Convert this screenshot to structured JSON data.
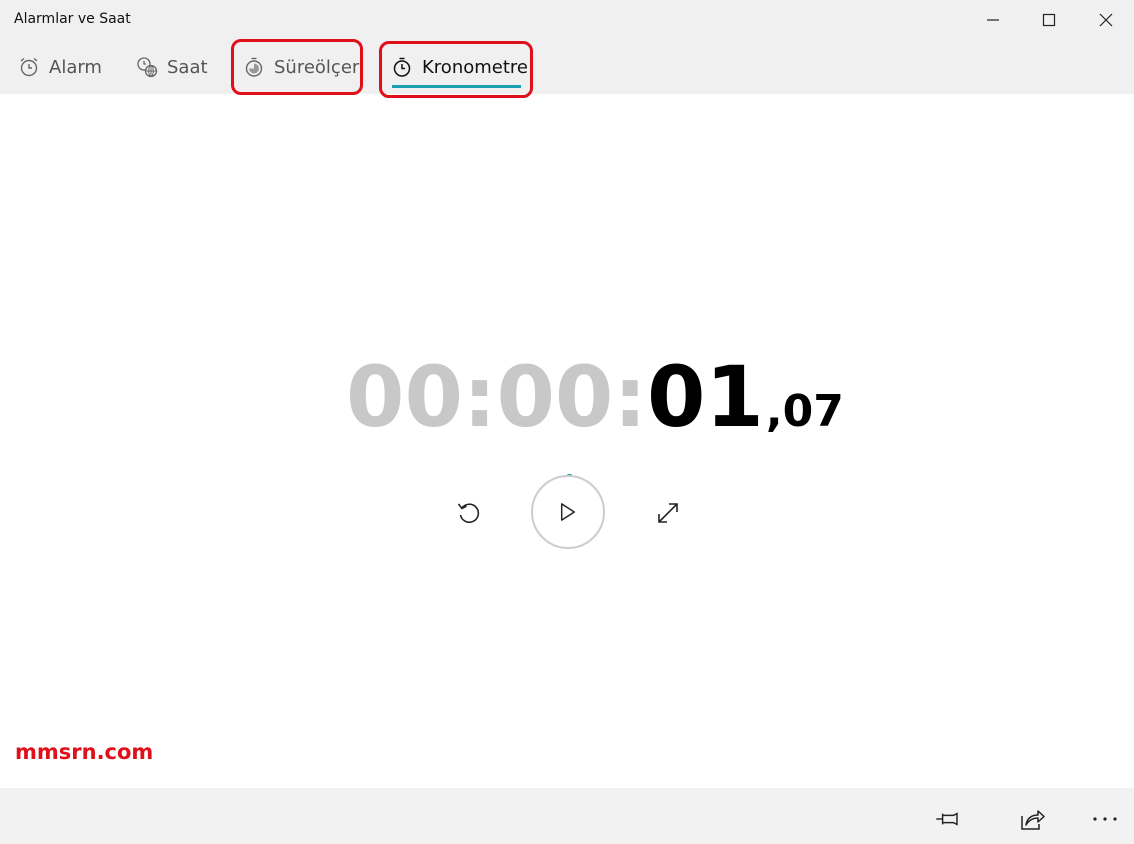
{
  "window": {
    "title": "Alarmlar ve Saat"
  },
  "tabs": [
    {
      "label": "Alarm",
      "icon": "alarm-clock-icon",
      "active": false
    },
    {
      "label": "Saat",
      "icon": "world-clock-icon",
      "active": false
    },
    {
      "label": "Süreölçer",
      "icon": "timer-icon",
      "active": false
    },
    {
      "label": "Kronometre",
      "icon": "stopwatch-icon",
      "active": true
    }
  ],
  "stopwatch": {
    "hours_minutes": "00:00:",
    "seconds": "01",
    "fraction": ",07"
  },
  "watermark": "mmsrn.com",
  "colors": {
    "accent": "#1aa0b0",
    "highlight": "#e0101a",
    "dim_digits": "#c8c8c8",
    "chrome": "#f0f0f0"
  }
}
